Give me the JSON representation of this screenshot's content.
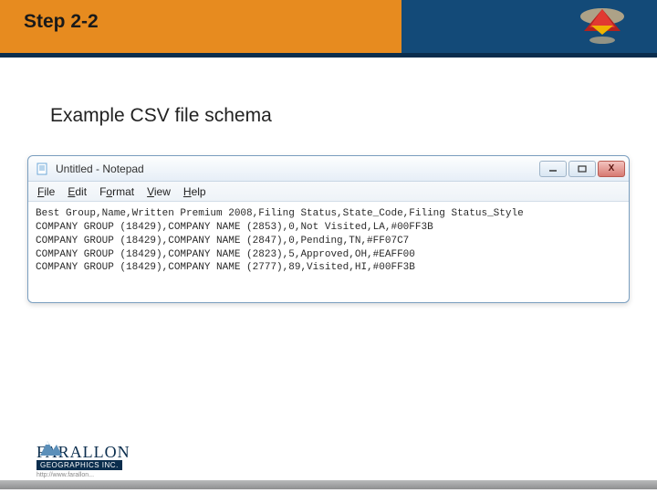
{
  "header": {
    "title": "Step 2-2"
  },
  "subtitle": "Example CSV file schema",
  "notepad": {
    "window_title": "Untitled - Notepad",
    "menus": {
      "file": "File",
      "edit": "Edit",
      "format": "Format",
      "view": "View",
      "help": "Help"
    },
    "content": "Best Group,Name,Written Premium 2008,Filing Status,State_Code,Filing Status_Style\nCOMPANY GROUP (18429),COMPANY NAME (2853),0,Not Visited,LA,#00FF3B\nCOMPANY GROUP (18429),COMPANY NAME (2847),0,Pending,TN,#FF07C7\nCOMPANY GROUP (18429),COMPANY NAME (2823),5,Approved,OH,#EAFF00\nCOMPANY GROUP (18429),COMPANY NAME (2777),89,Visited,HI,#00FF3B"
  },
  "footer": {
    "company": "FARALLON",
    "tagline": "GEOGRAPHICS INC.",
    "url": "http://www.farallon..."
  }
}
